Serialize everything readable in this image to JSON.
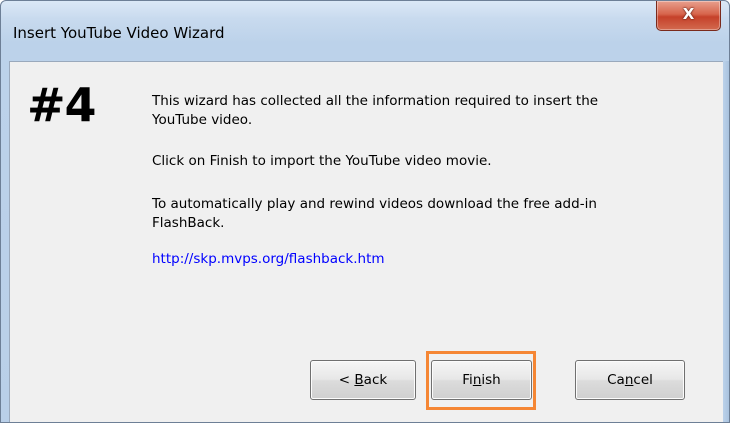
{
  "window": {
    "title": "Insert YouTube Video Wizard",
    "close_glyph": "X"
  },
  "content": {
    "step_number": "#4",
    "paragraph_1": "This wizard has collected all the information required to insert the YouTube video.",
    "paragraph_2": "Click on Finish to import the YouTube video movie.",
    "paragraph_3": "To automatically play and rewind videos download the free add-in FlashBack.",
    "link": "http://skp.mvps.org/flashback.htm"
  },
  "buttons": {
    "back": {
      "before": "< ",
      "mnemonic": "B",
      "after": "ack"
    },
    "finish": {
      "before": "Fi",
      "mnemonic": "n",
      "after": "ish"
    },
    "cancel": {
      "before": "Ca",
      "mnemonic": "n",
      "after": "cel"
    }
  },
  "colors": {
    "highlight": "#f58634",
    "link": "#0000ff",
    "close_button": "#c5412a"
  },
  "icons": {
    "close": "close-icon"
  }
}
